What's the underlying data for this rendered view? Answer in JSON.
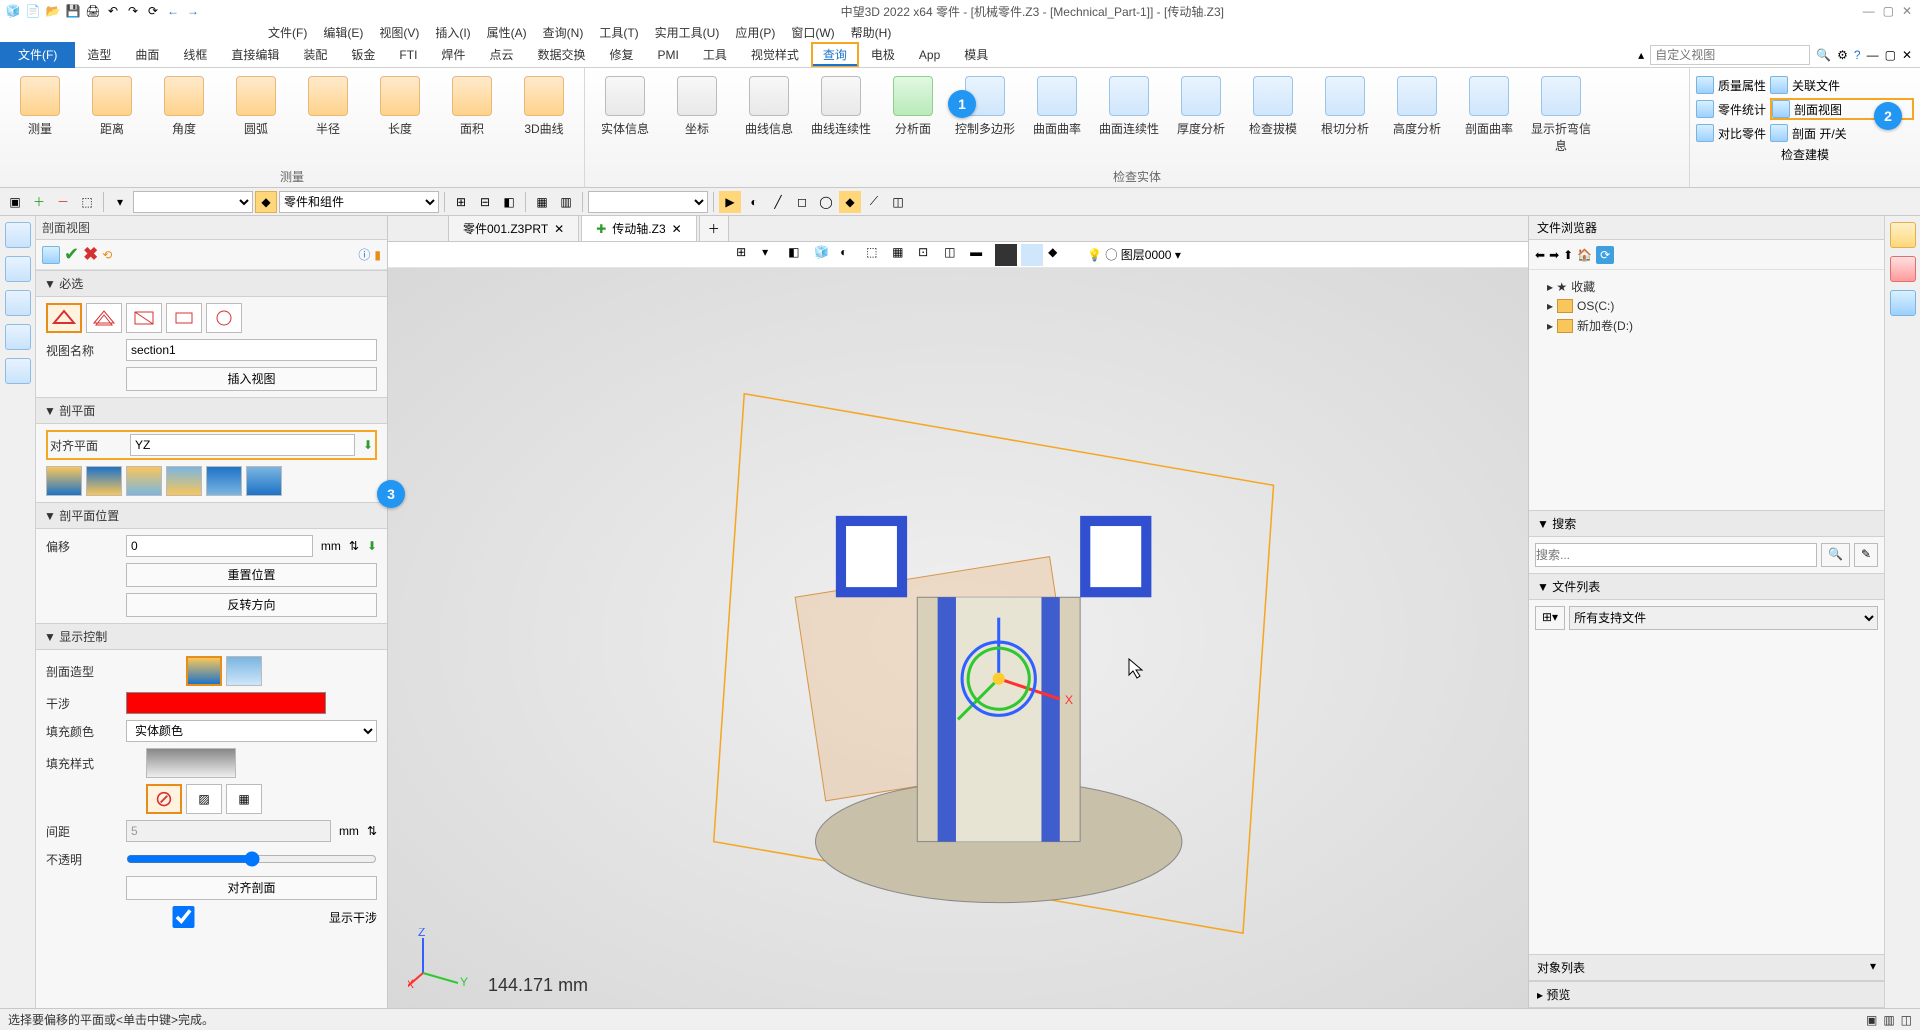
{
  "title": "中望3D 2022 x64     零件 - [机械零件.Z3 - [Mechnical_Part-1]] - [传动轴.Z3]",
  "menubar": [
    "文件(F)",
    "编辑(E)",
    "视图(V)",
    "插入(I)",
    "属性(A)",
    "查询(N)",
    "工具(T)",
    "实用工具(U)",
    "应用(P)",
    "窗口(W)",
    "帮助(H)"
  ],
  "ribbontabs": {
    "file": "文件(F)",
    "tabs": [
      "造型",
      "曲面",
      "线框",
      "直接编辑",
      "装配",
      "钣金",
      "FTI",
      "焊件",
      "点云",
      "数据交换",
      "修复",
      "PMI",
      "工具",
      "视觉样式",
      "查询",
      "电极",
      "App",
      "模具"
    ],
    "active": "查询",
    "search_placeholder": "自定义视图"
  },
  "ribbon": {
    "g1": {
      "label": "测量",
      "btns": [
        "测量",
        "距离",
        "角度",
        "圆弧",
        "半径",
        "长度",
        "面积",
        "3D曲线"
      ]
    },
    "g2": {
      "label": "",
      "btns": [
        "实体信息",
        "坐标",
        "曲线信息",
        "曲线连续性",
        "分析面",
        "控制多边形",
        "曲面曲率",
        "曲面连续性",
        "厚度分析",
        "检查拔模",
        "根切分析",
        "高度分析",
        "剖面曲率",
        "显示折弯信息"
      ],
      "grplabel": "检查实体"
    },
    "side": {
      "r1": [
        "质量属性",
        "关联文件"
      ],
      "r2": [
        "零件统计",
        "剖面视图"
      ],
      "r3": [
        "对比零件",
        "剖面 开/关"
      ],
      "grplabel": "检查建模"
    }
  },
  "bubbles": {
    "b1": "1",
    "b2": "2",
    "b3": "3"
  },
  "toolstrip": {
    "combo": "零件和组件"
  },
  "doctabs": {
    "t1": "零件001.Z3PRT",
    "t2": "传动轴.Z3"
  },
  "viewtools_layer": "图层0000",
  "leftpanel": {
    "title": "剖面视图",
    "sec_required": "必选",
    "view_name_label": "视图名称",
    "view_name": "section1",
    "insert": "插入视图",
    "sec_plane": "剖平面",
    "align_label": "对齐平面",
    "align_value": "YZ",
    "sec_planepos": "剖平面位置",
    "offset_label": "偏移",
    "offset_value": "0",
    "offset_unit": "mm",
    "reset": "重置位置",
    "flip": "反转方向",
    "sec_disp": "显示控制",
    "sculpt": "剖面造型",
    "interf": "干涉",
    "fillc": "填充颜色",
    "fillc_val": "实体颜色",
    "fillp": "填充样式",
    "spacing": "间距",
    "spacing_val": "5",
    "spacing_unit": "mm",
    "opacity": "不透明",
    "alignsec": "对齐剖面",
    "showint": "显示干涉"
  },
  "rightpanel": {
    "title": "文件浏览器",
    "tree": {
      "fav": "收藏",
      "c": "OS(C:)",
      "d": "新加卷(D:)"
    },
    "search_h": "搜索",
    "search_ph": "搜索...",
    "flist_h": "文件列表",
    "flist_val": "所有支持文件",
    "objlist": "对象列表",
    "preview": "预览"
  },
  "viewport": {
    "measure": "144.171 mm"
  },
  "statusbar": "选择要偏移的平面或<单击中键>完成。"
}
